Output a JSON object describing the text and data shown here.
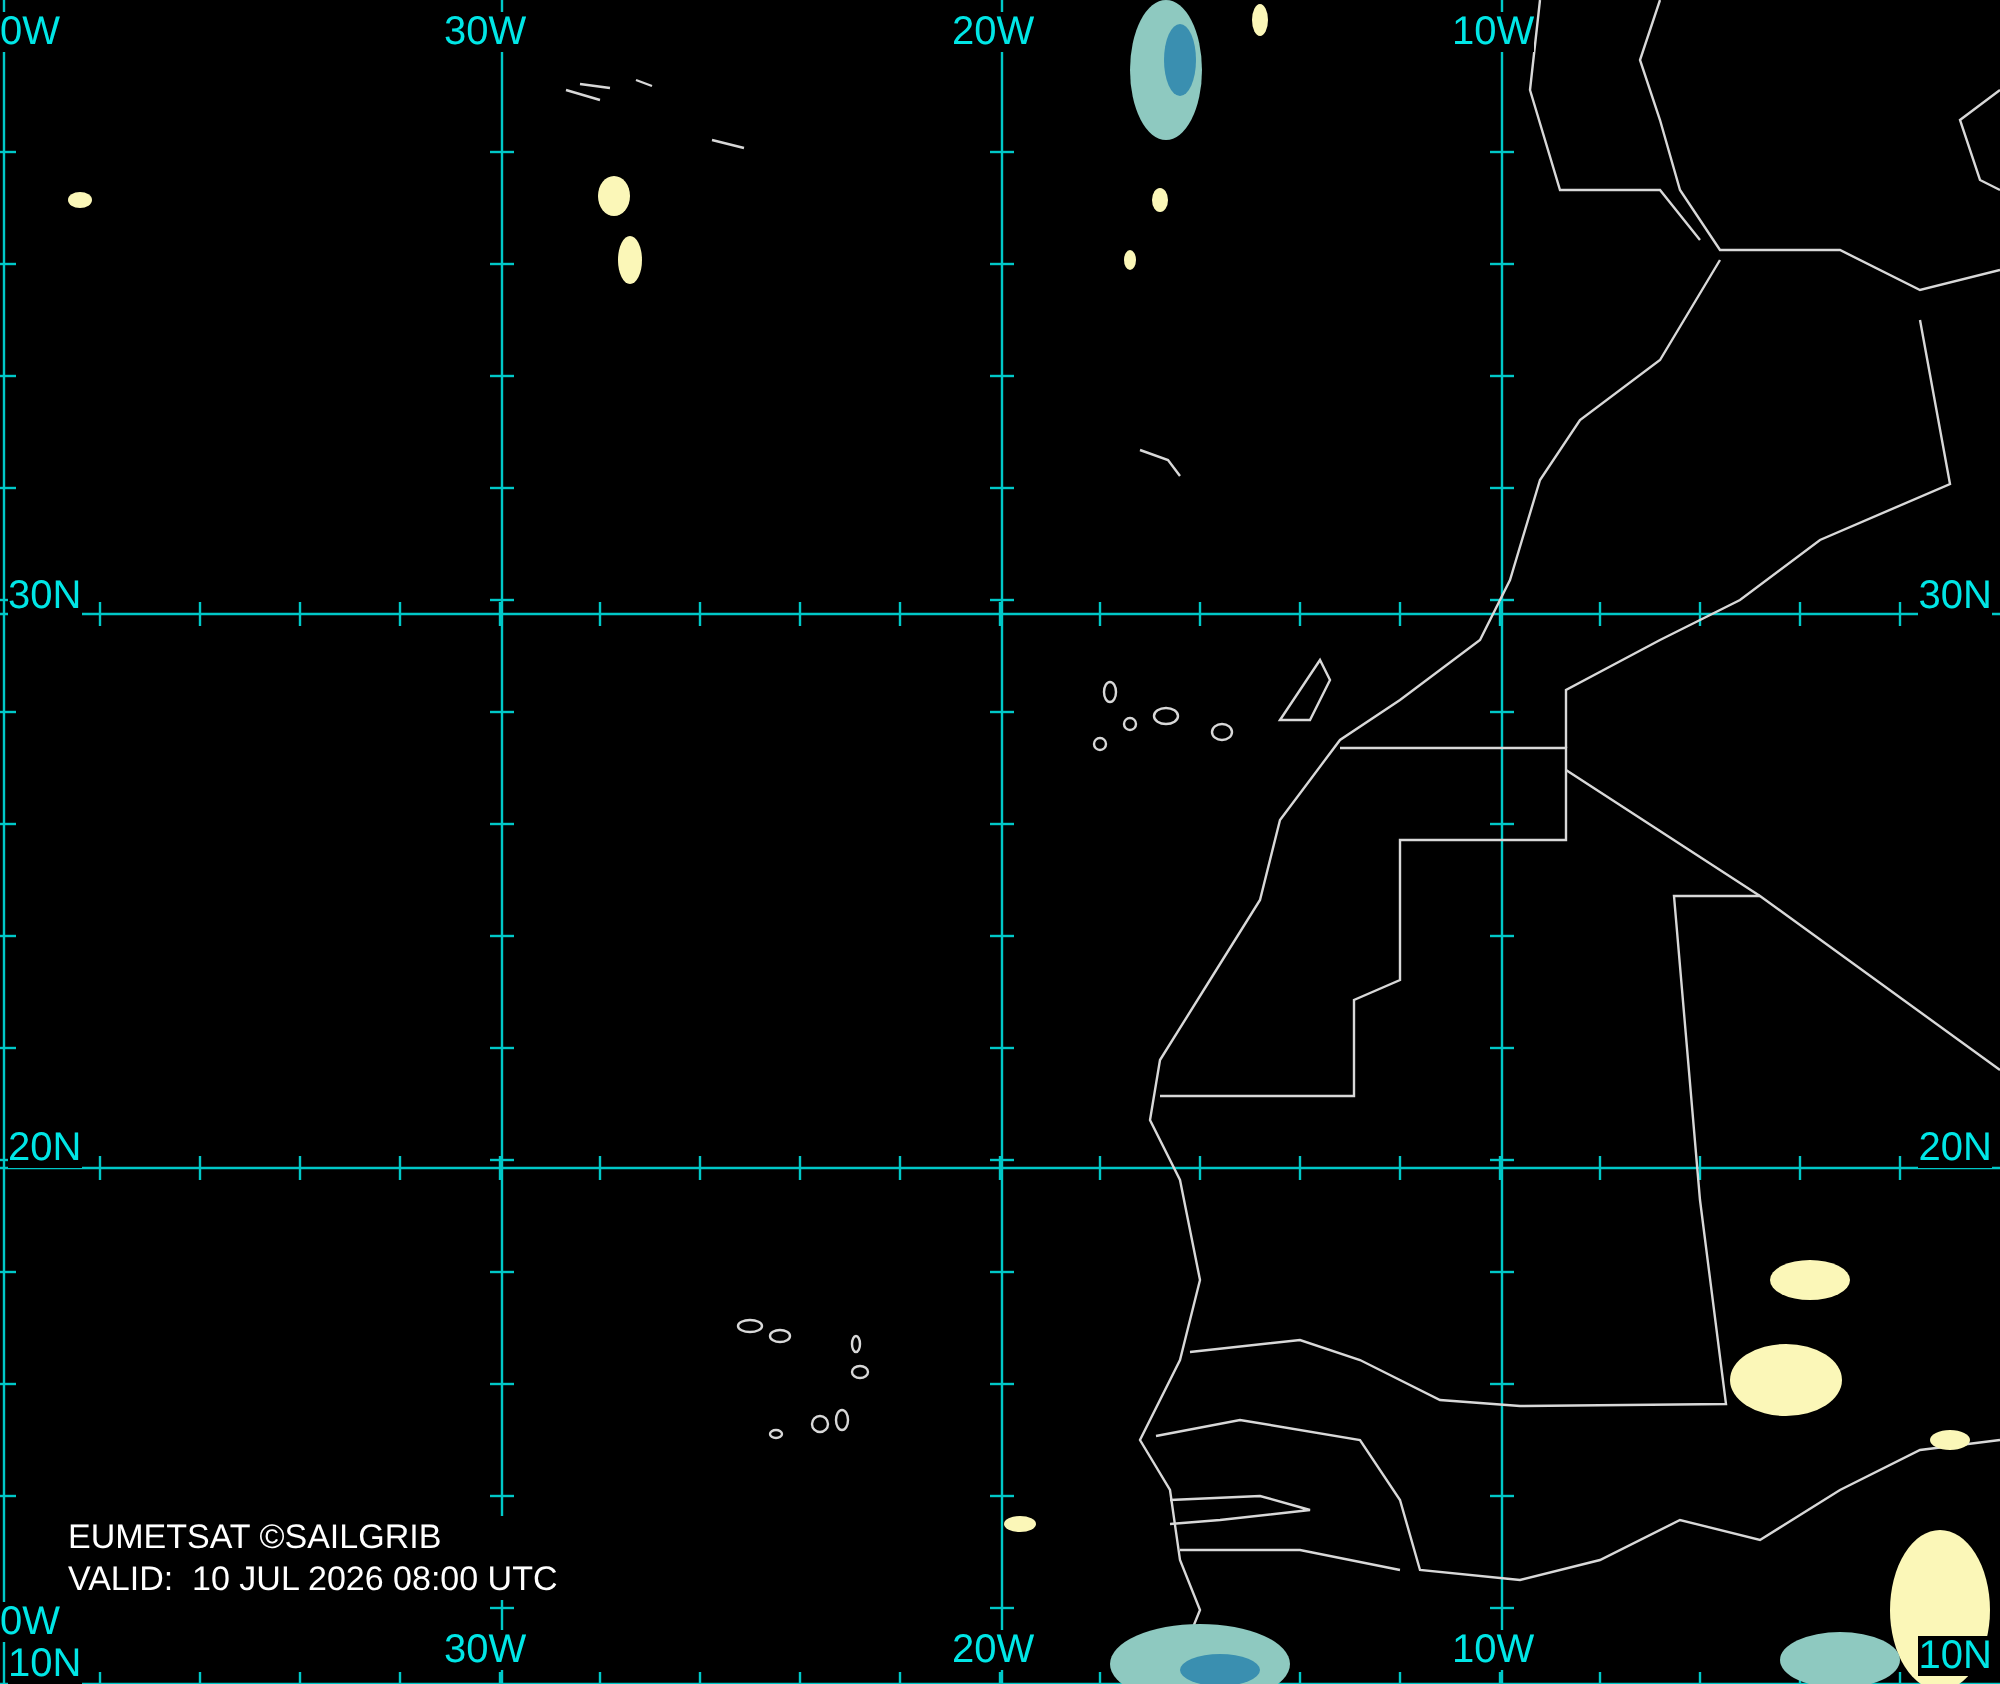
{
  "map": {
    "top_labels": [
      "0W",
      "30W",
      "20W",
      "10W"
    ],
    "bottom_labels": [
      "0W",
      "30W",
      "20W",
      "10W"
    ],
    "left_labels": [
      "30N",
      "20N",
      "10N"
    ],
    "right_labels": [
      "30N",
      "20N",
      "10N"
    ]
  },
  "caption": {
    "source": "EUMETSAT ©SAILGRIB",
    "valid": "VALID:  10 JUL 2026 08:00 UTC"
  }
}
